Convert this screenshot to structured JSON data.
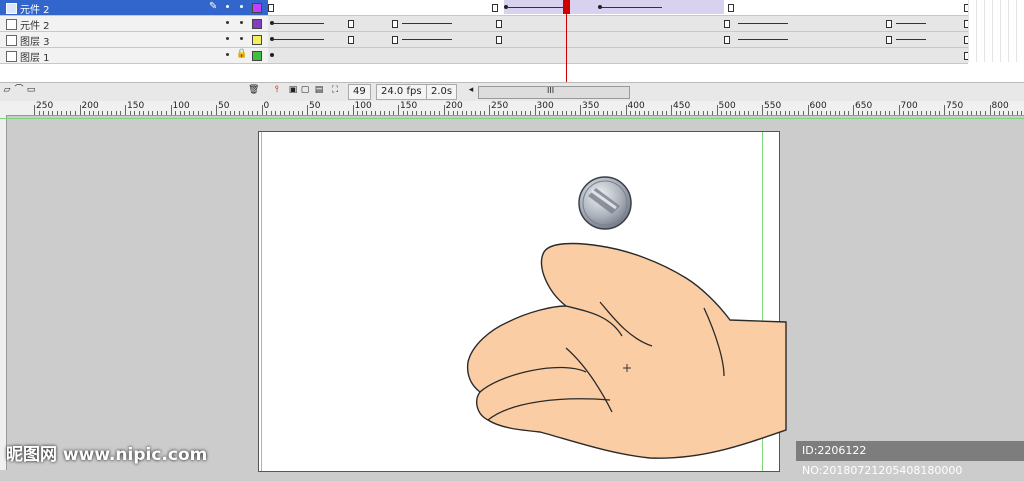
{
  "layers": [
    {
      "name": "元件 2",
      "active": true,
      "color": "#c040ff",
      "locked": false,
      "editing": true
    },
    {
      "name": "元件 2",
      "active": false,
      "color": "#8040c0",
      "locked": false,
      "editing": false
    },
    {
      "name": "图层 3",
      "active": false,
      "color": "#f0f060",
      "locked": false,
      "editing": false
    },
    {
      "name": "图层 1",
      "active": false,
      "color": "#40c040",
      "locked": true,
      "editing": false
    }
  ],
  "status": {
    "current_frame": "49",
    "frame_rate": "24.0 fps",
    "elapsed_time": "2.0s",
    "scroll_grip": "III"
  },
  "ruler": {
    "labels": [
      "250",
      "200",
      "150",
      "100",
      "50",
      "0",
      "50",
      "100",
      "150",
      "200",
      "250",
      "300",
      "350",
      "400",
      "450",
      "500",
      "550",
      "600",
      "650",
      "700",
      "750",
      "800"
    ]
  },
  "watermark": {
    "site": "昵图网 www.nipic.com",
    "id_text": "ID:2206122 NO:20180721205408180000"
  },
  "colors": {
    "skin": "#fbcda4",
    "coin": "#b8bec8",
    "timeline_active": "#3366cc",
    "playhead": "#cc0000"
  }
}
